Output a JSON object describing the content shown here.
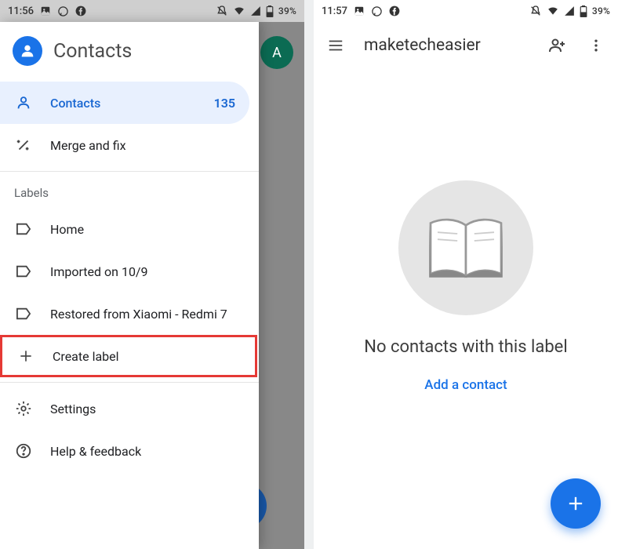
{
  "left": {
    "status": {
      "time": "11:56",
      "battery": "39%"
    },
    "avatar_letter": "A",
    "header_title": "Contacts",
    "nav": {
      "contacts_label": "Contacts",
      "contacts_count": "135",
      "merge_label": "Merge and fix"
    },
    "labels_section_title": "Labels",
    "labels": {
      "home": "Home",
      "imported": "Imported on 10/9",
      "restored": "Restored from Xiaomi - Redmi 7",
      "create": "Create label"
    },
    "footer": {
      "settings": "Settings",
      "help": "Help & feedback"
    }
  },
  "right": {
    "status": {
      "time": "11:57",
      "battery": "39%"
    },
    "title": "maketecheasier",
    "empty_message": "No contacts with this label",
    "add_contact": "Add a contact"
  }
}
